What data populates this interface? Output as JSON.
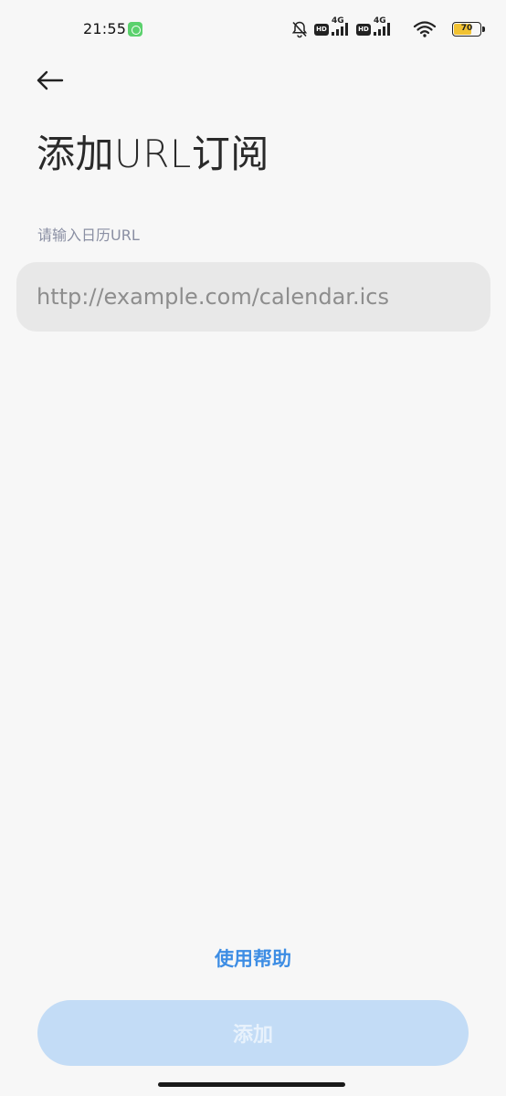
{
  "status_bar": {
    "time": "21:55",
    "hd_1": "HD",
    "network_1": "4G",
    "hd_2": "HD",
    "network_2": "4G",
    "battery_level": "70",
    "battery_fill_percent": 70,
    "icons": [
      "app-notification-icon",
      "mute-icon",
      "signal-icon",
      "wifi-icon",
      "battery-icon"
    ]
  },
  "header": {
    "back_icon": "arrow-left-icon",
    "title": "添加URL订阅"
  },
  "form": {
    "label": "请输入日历URL",
    "url_placeholder": "http://example.com/calendar.ics",
    "url_value": ""
  },
  "footer": {
    "help_link": "使用帮助",
    "add_button": "添加"
  },
  "colors": {
    "background": "#f7f7f7",
    "accent": "#3d8de4",
    "button_disabled_bg": "#c3dcf6",
    "input_bg": "#e8e8e8"
  }
}
